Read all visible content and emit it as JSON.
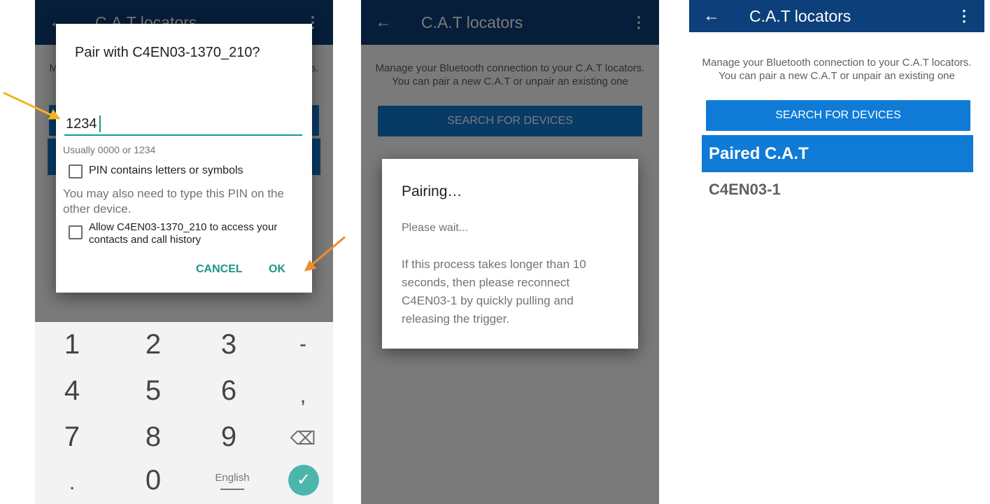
{
  "app_bar": {
    "back_glyph": "←",
    "title": "C.A.T locators",
    "menu_glyph": "⋮",
    "back_icon": "arrow-left-icon",
    "menu_icon": "more-vert-icon"
  },
  "main": {
    "intro_text": "Manage your Bluetooth connection to your C.A.T locators. You can pair a new C.A.T or unpair an existing one",
    "search_button": "SEARCH FOR DEVICES",
    "paired_header": "Paired C.A.T",
    "paired_devices": [
      "C4EN03-1"
    ]
  },
  "pair_dialog": {
    "title": "Pair with C4EN03-1370_210?",
    "pin_value": "1234",
    "hint": "Usually 0000 or 1234",
    "pin_letters_label": "PIN contains letters or symbols",
    "info": "You may also need to type this PIN on the other device.",
    "contacts_label": "Allow C4EN03-1370_210 to access your contacts and call history",
    "cancel": "CANCEL",
    "ok": "OK"
  },
  "keypad": {
    "rows": [
      [
        "1",
        "2",
        "3",
        "-"
      ],
      [
        "4",
        "5",
        "6",
        ","
      ],
      [
        "7",
        "8",
        "9",
        "⌫"
      ],
      [
        ".",
        "0",
        "English",
        "✓"
      ]
    ],
    "backspace_icon": "backspace-icon",
    "done_icon": "check-circle-icon"
  },
  "pairing_dialog": {
    "title": "Pairing…",
    "wait": "Please wait...",
    "message": "If this process takes longer than 10 seconds, then please reconnect C4EN03-1 by quickly pulling and releasing the trigger."
  },
  "colors": {
    "app_bar": "#0d3f7a",
    "primary": "#0f7bd6",
    "accent": "#1a9688",
    "keypad_bg": "#f3f3f3",
    "annotation_arrow_1": "#f4b323",
    "annotation_arrow_2": "#f08c2e"
  }
}
